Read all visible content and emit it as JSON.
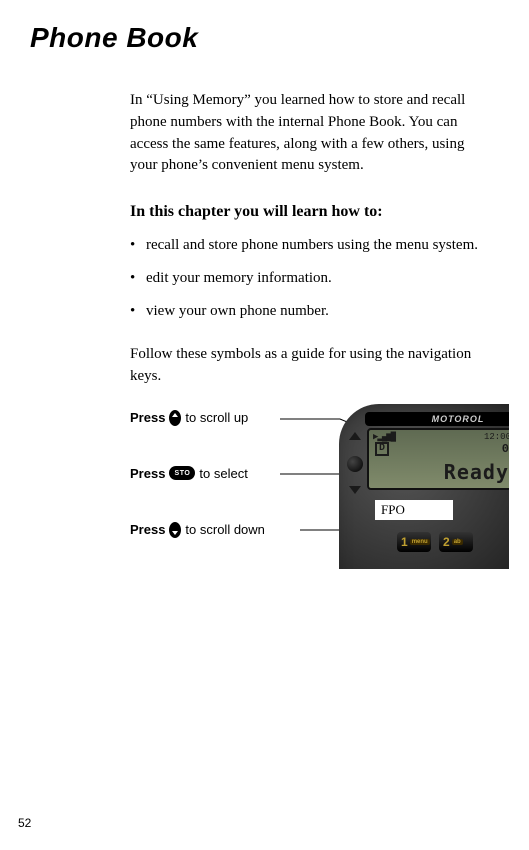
{
  "title": "Phone Book",
  "intro": "In “Using Memory” you learned how to store and recall phone numbers with the internal Phone Book. You can access the same features, along with a few others, using your phone’s convenient menu system.",
  "subhead": "In this chapter you will learn how to:",
  "learn_items": [
    "recall and store phone numbers using the menu system.",
    "edit your memory information.",
    "view your own phone number."
  ],
  "follow": "Follow these symbols as a guide for using the navigation keys.",
  "keys": {
    "up": {
      "press": "Press",
      "label": " to scroll up"
    },
    "sel": {
      "press": "Press",
      "sto": "STO",
      "label": " to select"
    },
    "down": {
      "press": "Press",
      "label": " to scroll down"
    }
  },
  "phone": {
    "brand": "MOTOROL",
    "time": "12:00",
    "signal": "▶▂▄▆█",
    "d": "D",
    "zero": "0",
    "ready": "Ready",
    "fpo": "FPO",
    "key1_num": "1",
    "key1_sub": "menu",
    "key2_num": "2",
    "key2_sub": "ab"
  },
  "page_number": "52"
}
